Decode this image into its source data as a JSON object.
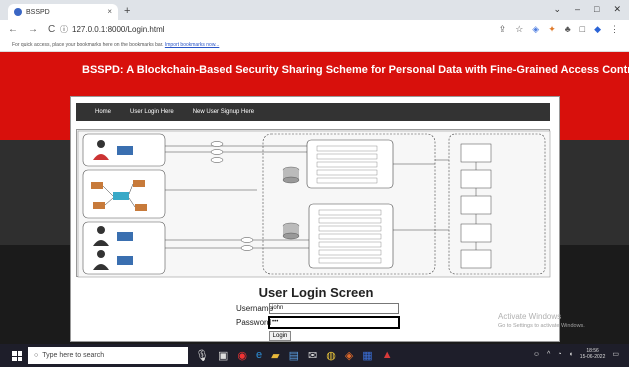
{
  "browser": {
    "tab_title": "BSSPD",
    "tab_close": "×",
    "new_tab": "+",
    "window_controls": [
      "⌄",
      "–",
      "□",
      "✕"
    ],
    "nav_icons": [
      "←",
      "→",
      "C"
    ],
    "info_icon": "ⓘ",
    "url": "127.0.0.1:8000/Login.html",
    "extension_icons": [
      "⇪",
      "☆",
      "◈",
      "✦",
      "♣",
      "□",
      "◆",
      "⋮"
    ],
    "bookmarks_text": "For quick access, place your bookmarks here on the bookmarks bar.",
    "bookmarks_link": "Import bookmarks now..."
  },
  "page": {
    "banner_title": "BSSPD: A Blockchain-Based Security Sharing Scheme for Personal Data with Fine-Grained Access Control",
    "nav_links": [
      "Home",
      "User Login Here",
      "New User Signup Here"
    ],
    "form_title": "User Login Screen",
    "username_label": "Username",
    "username_value": "john",
    "password_label": "Password",
    "password_value": "•••",
    "login_button": "Login",
    "colors": {
      "banner": "#d8100c",
      "nav": "#333333"
    }
  },
  "watermark": {
    "line1": "Activate Windows",
    "line2": "Go to Settings to activate Windows."
  },
  "taskbar": {
    "search_placeholder": "Type here to search",
    "time": "18:56",
    "date": "15-06-2022",
    "icons": [
      "mic-icon",
      "task-view-icon",
      "opera-icon",
      "edge-icon",
      "folder-icon",
      "store-icon",
      "mail-icon",
      "chrome-icon",
      "media-icon",
      "word-icon",
      "acrobat-icon"
    ]
  }
}
